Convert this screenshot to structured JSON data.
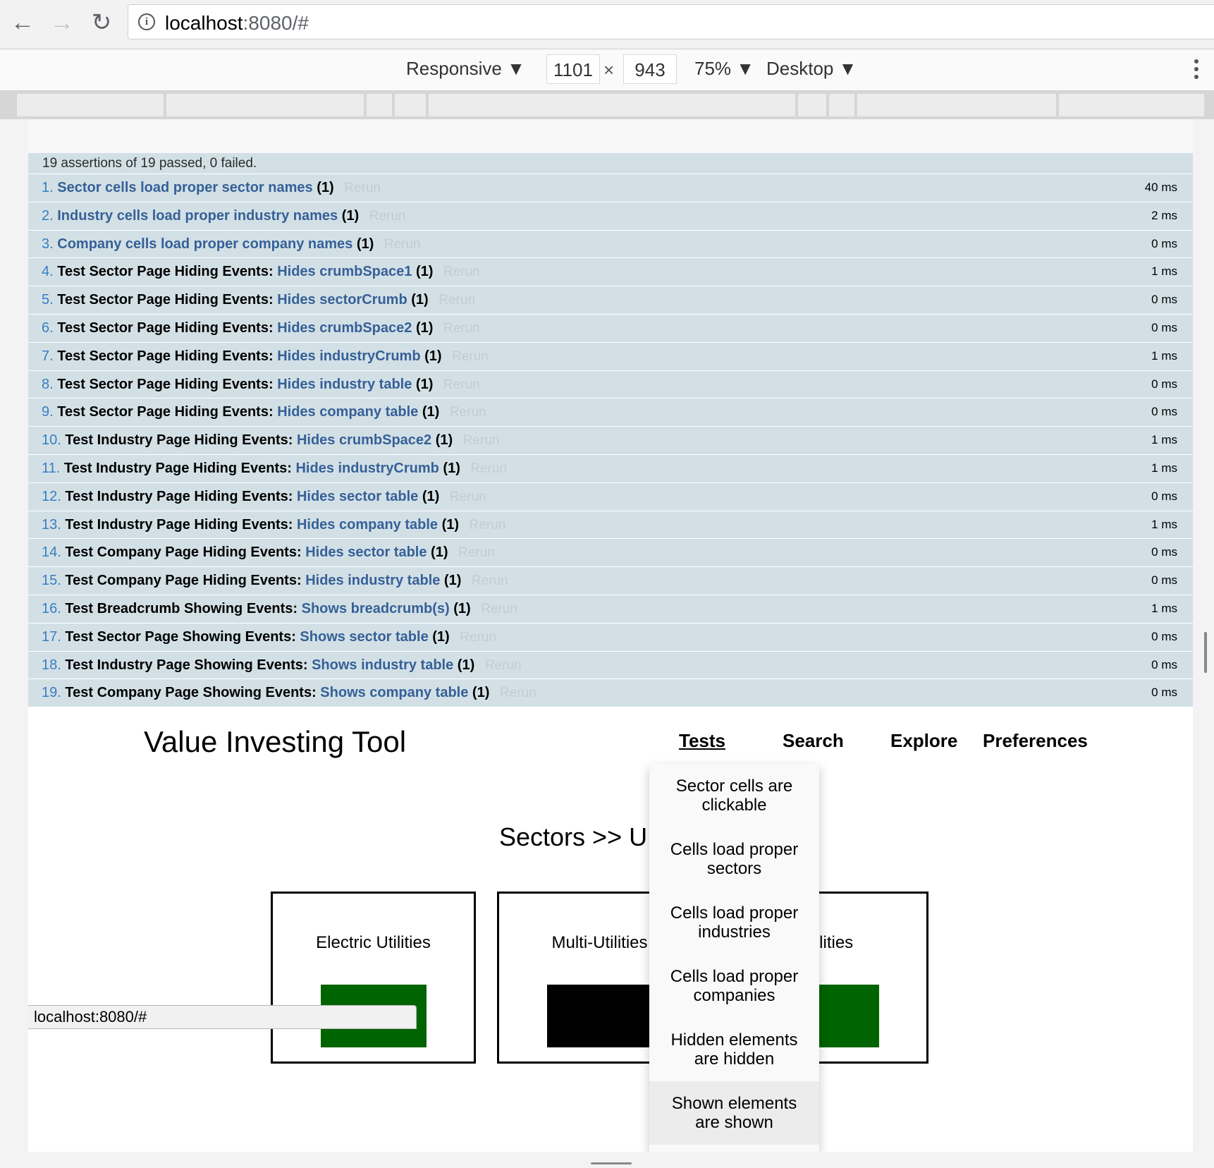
{
  "browser": {
    "url_host": "localhost",
    "url_path": ":8080/#",
    "back_glyph": "←",
    "forward_glyph": "→",
    "reload_glyph": "↻"
  },
  "devtools": {
    "mode": "Responsive ▼",
    "width": "1101",
    "times": "×",
    "height": "943",
    "zoom": "75% ▼",
    "device": "Desktop ▼"
  },
  "qunit": {
    "summary": "19 assertions of 19 passed, 0 failed.",
    "rerun_label": "Rerun",
    "tests": [
      {
        "num": "1.",
        "module": "",
        "name": "Sector cells load proper sector names",
        "counts": "(1)",
        "time": "40 ms"
      },
      {
        "num": "2.",
        "module": "",
        "name": "Industry cells load proper industry names",
        "counts": "(1)",
        "time": "2 ms"
      },
      {
        "num": "3.",
        "module": "",
        "name": "Company cells load proper company names",
        "counts": "(1)",
        "time": "0 ms"
      },
      {
        "num": "4.",
        "module": "Test Sector Page Hiding Events:",
        "name": "Hides crumbSpace1",
        "counts": "(1)",
        "time": "1 ms"
      },
      {
        "num": "5.",
        "module": "Test Sector Page Hiding Events:",
        "name": "Hides sectorCrumb",
        "counts": "(1)",
        "time": "0 ms"
      },
      {
        "num": "6.",
        "module": "Test Sector Page Hiding Events:",
        "name": "Hides crumbSpace2",
        "counts": "(1)",
        "time": "0 ms"
      },
      {
        "num": "7.",
        "module": "Test Sector Page Hiding Events:",
        "name": "Hides industryCrumb",
        "counts": "(1)",
        "time": "1 ms"
      },
      {
        "num": "8.",
        "module": "Test Sector Page Hiding Events:",
        "name": "Hides industry table",
        "counts": "(1)",
        "time": "0 ms"
      },
      {
        "num": "9.",
        "module": "Test Sector Page Hiding Events:",
        "name": "Hides company table",
        "counts": "(1)",
        "time": "0 ms"
      },
      {
        "num": "10.",
        "module": "Test Industry Page Hiding Events:",
        "name": "Hides crumbSpace2",
        "counts": "(1)",
        "time": "1 ms"
      },
      {
        "num": "11.",
        "module": "Test Industry Page Hiding Events:",
        "name": "Hides industryCrumb",
        "counts": "(1)",
        "time": "1 ms"
      },
      {
        "num": "12.",
        "module": "Test Industry Page Hiding Events:",
        "name": "Hides sector table",
        "counts": "(1)",
        "time": "0 ms"
      },
      {
        "num": "13.",
        "module": "Test Industry Page Hiding Events:",
        "name": "Hides company table",
        "counts": "(1)",
        "time": "1 ms"
      },
      {
        "num": "14.",
        "module": "Test Company Page Hiding Events:",
        "name": "Hides sector table",
        "counts": "(1)",
        "time": "0 ms"
      },
      {
        "num": "15.",
        "module": "Test Company Page Hiding Events:",
        "name": "Hides industry table",
        "counts": "(1)",
        "time": "0 ms"
      },
      {
        "num": "16.",
        "module": "Test Breadcrumb Showing Events:",
        "name": "Shows breadcrumb(s)",
        "counts": "(1)",
        "time": "1 ms"
      },
      {
        "num": "17.",
        "module": "Test Sector Page Showing Events:",
        "name": "Shows sector table",
        "counts": "(1)",
        "time": "0 ms"
      },
      {
        "num": "18.",
        "module": "Test Industry Page Showing Events:",
        "name": "Shows industry table",
        "counts": "(1)",
        "time": "0 ms"
      },
      {
        "num": "19.",
        "module": "Test Company Page Showing Events:",
        "name": "Shows company table",
        "counts": "(1)",
        "time": "0 ms"
      }
    ]
  },
  "app": {
    "title": "Value Investing Tool",
    "nav": {
      "tests": "Tests",
      "search": "Search",
      "explore": "Explore",
      "preferences": "Preferences"
    },
    "breadcrumb": "Sectors  >>  U",
    "cards": [
      {
        "label": "Electric Utilities",
        "swatch_color": "#006400"
      },
      {
        "label": "Multi-Utilities",
        "swatch_color": "#000000"
      },
      {
        "label": " Utilities",
        "swatch_color": "#006400"
      }
    ],
    "tests_menu": [
      "Sector cells are clickable",
      "Cells load proper sectors",
      "Cells load proper industries",
      "Cells load proper companies",
      "Hidden elements are hidden",
      "Shown elements are shown"
    ]
  },
  "status_bar": {
    "text": "localhost:8080/#"
  }
}
